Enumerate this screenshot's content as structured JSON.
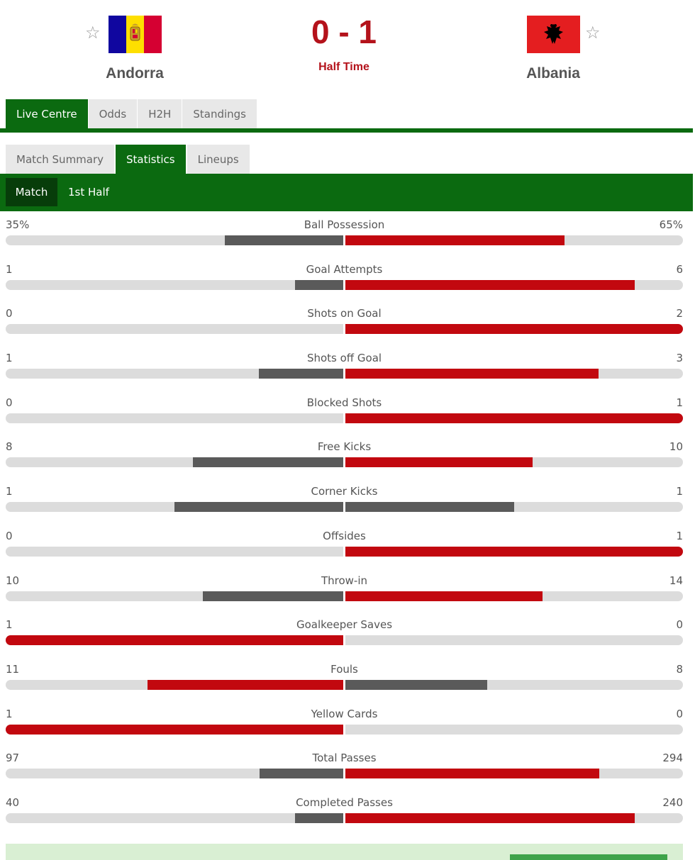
{
  "match": {
    "home_team": "Andorra",
    "away_team": "Albania",
    "score": "0 - 1",
    "status": "Half Time",
    "star_glyph": "☆"
  },
  "top_tabs": [
    "Live Centre",
    "Odds",
    "H2H",
    "Standings"
  ],
  "sub_tabs": [
    "Match Summary",
    "Statistics",
    "Lineups"
  ],
  "periods": [
    "Match",
    "1st Half"
  ],
  "colors": {
    "primary_green": "#0b6a10",
    "leading_red": "#c2080f",
    "trailing_gray": "#5a5a5a"
  },
  "stats": [
    {
      "label": "Ball Possession",
      "home": "35%",
      "away": "65%",
      "home_value": 35,
      "away_value": 65
    },
    {
      "label": "Goal Attempts",
      "home": "1",
      "away": "6",
      "home_value": 1,
      "away_value": 6
    },
    {
      "label": "Shots on Goal",
      "home": "0",
      "away": "2",
      "home_value": 0,
      "away_value": 2
    },
    {
      "label": "Shots off Goal",
      "home": "1",
      "away": "3",
      "home_value": 1,
      "away_value": 3
    },
    {
      "label": "Blocked Shots",
      "home": "0",
      "away": "1",
      "home_value": 0,
      "away_value": 1
    },
    {
      "label": "Free Kicks",
      "home": "8",
      "away": "10",
      "home_value": 8,
      "away_value": 10
    },
    {
      "label": "Corner Kicks",
      "home": "1",
      "away": "1",
      "home_value": 1,
      "away_value": 1
    },
    {
      "label": "Offsides",
      "home": "0",
      "away": "1",
      "home_value": 0,
      "away_value": 1
    },
    {
      "label": "Throw-in",
      "home": "10",
      "away": "14",
      "home_value": 10,
      "away_value": 14
    },
    {
      "label": "Goalkeeper Saves",
      "home": "1",
      "away": "0",
      "home_value": 1,
      "away_value": 0
    },
    {
      "label": "Fouls",
      "home": "11",
      "away": "8",
      "home_value": 11,
      "away_value": 8
    },
    {
      "label": "Yellow Cards",
      "home": "1",
      "away": "0",
      "home_value": 1,
      "away_value": 0
    },
    {
      "label": "Total Passes",
      "home": "97",
      "away": "294",
      "home_value": 97,
      "away_value": 294
    },
    {
      "label": "Completed Passes",
      "home": "40",
      "away": "240",
      "home_value": 40,
      "away_value": 240
    }
  ]
}
